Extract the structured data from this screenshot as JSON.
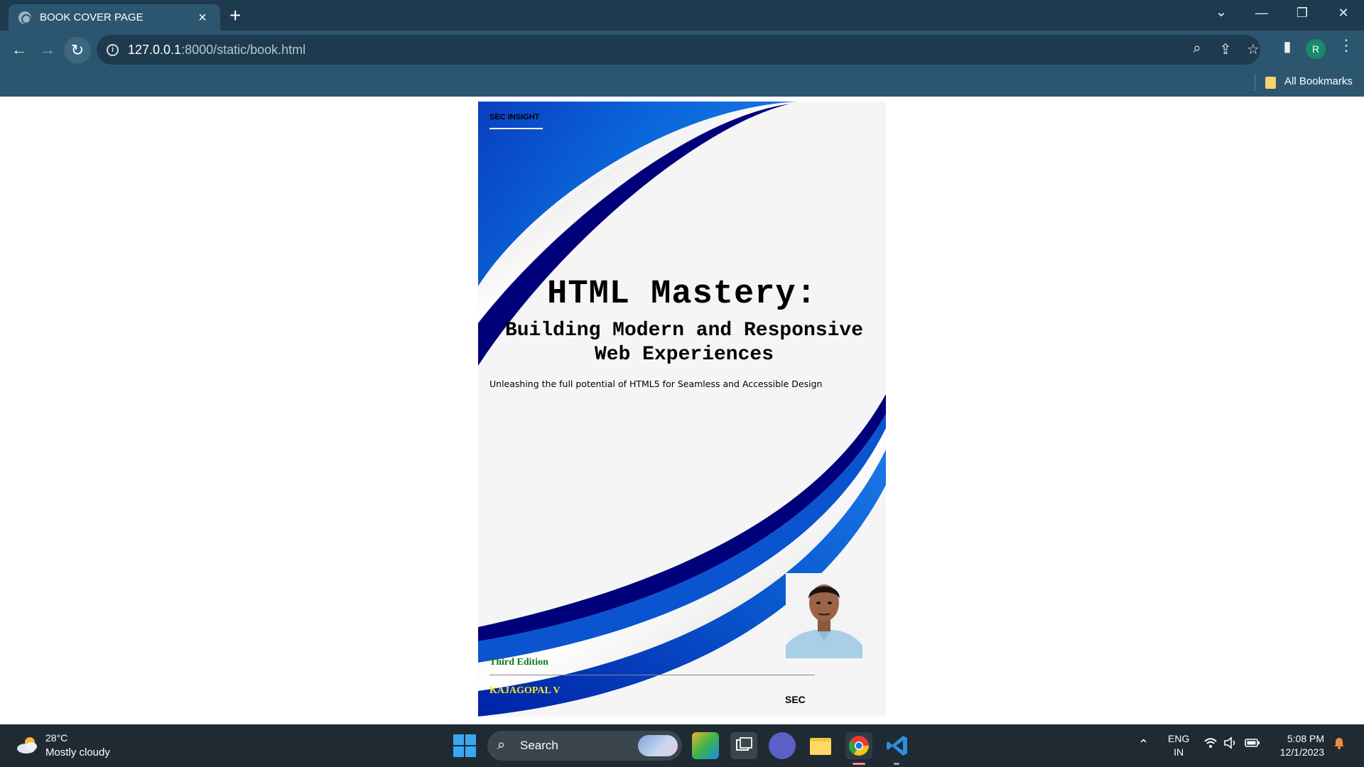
{
  "browser": {
    "tab": {
      "title": "BOOK COVER PAGE",
      "close_icon": "close-icon",
      "favicon": "globe-icon"
    },
    "new_tab_icon": "plus-icon",
    "window_controls": {
      "tab_search": "⌄",
      "minimize": "—",
      "restore": "❐",
      "close": "✕"
    },
    "url": {
      "host": "127.0.0.1",
      "rest": ":8000/static/book.html"
    },
    "profile_initial": "R",
    "bookmarks": {
      "all_bookmarks_label": "All Bookmarks"
    }
  },
  "cover": {
    "brand": "SEC INSIGHT",
    "title": "HTML Mastery:",
    "subtitle_line1": "Building Modern and Responsive",
    "subtitle_line2": "Web Experiences",
    "tagline": "Unleashing the full potential of HTML5 for Seamless and Accessible Design",
    "edition": "Third Edition",
    "author": "KAJAGOPAL V",
    "publisher": "SEC",
    "colors": {
      "deep_blue": "#00007a",
      "bright_blue": "#0a5fd6",
      "edition_green": "#0b7a1a",
      "author_yellow": "#f7e81e"
    }
  },
  "taskbar": {
    "weather": {
      "temp": "28°C",
      "desc": "Mostly cloudy"
    },
    "search_label": "Search",
    "language": {
      "line1": "ENG",
      "line2": "IN"
    },
    "clock": {
      "time": "5:08 PM",
      "date": "12/1/2023"
    }
  }
}
